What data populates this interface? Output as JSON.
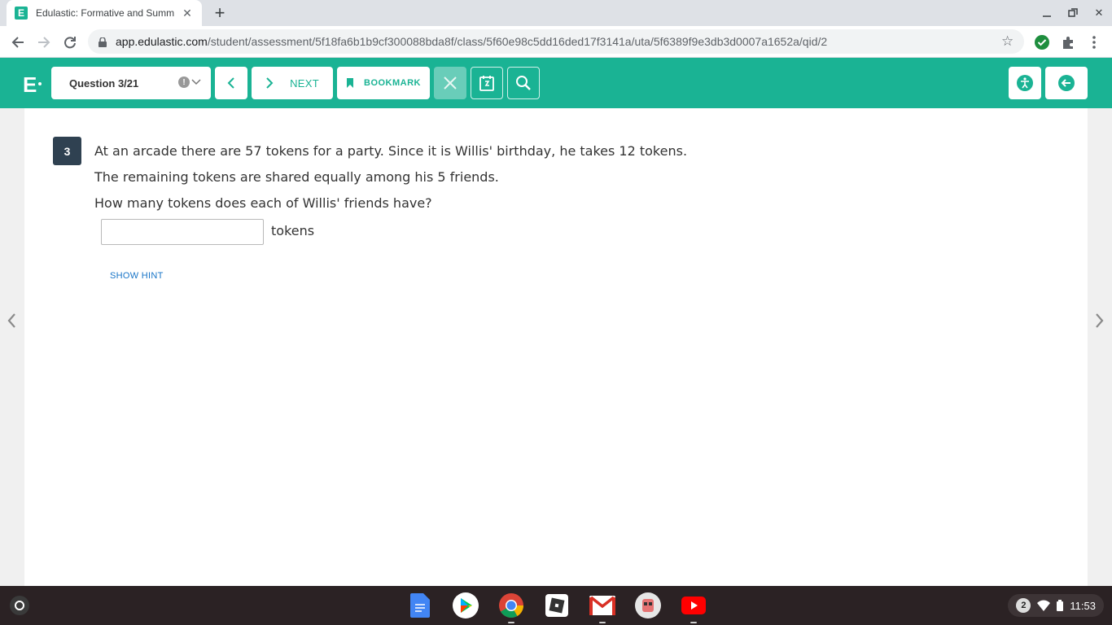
{
  "browser": {
    "tab_title": "Edulastic: Formative and Summ",
    "url_host": "app.edulastic.com",
    "url_path": "/student/assessment/5f18fa6b1b9cf300088bda8f/class/5f60e98c5dd16ded17f3141a/uta/5f6389f9e3db3d0007a1652a/qid/2",
    "favicon_letter": "E"
  },
  "header": {
    "logo": "E",
    "question_selector": "Question 3/21",
    "next_label": "NEXT",
    "bookmark_label": "BOOKMARK",
    "accent_color": "#1ab394"
  },
  "question": {
    "number": "3",
    "line1": "At an arcade there are 57 tokens for a party.  Since it is Willis' birthday, he takes 12 tokens.",
    "line2": "The remaining tokens are shared equally among his 5 friends.",
    "line3": "How many tokens does each of Willis' friends have?",
    "answer_value": "",
    "unit_label": "tokens",
    "hint_label": "SHOW HINT"
  },
  "shelf": {
    "apps": [
      "docs-icon",
      "play-store-icon",
      "chrome-icon",
      "roblox-icon",
      "gmail-icon",
      "game-icon",
      "youtube-icon"
    ],
    "notification_count": "2",
    "clock": "11:53"
  }
}
